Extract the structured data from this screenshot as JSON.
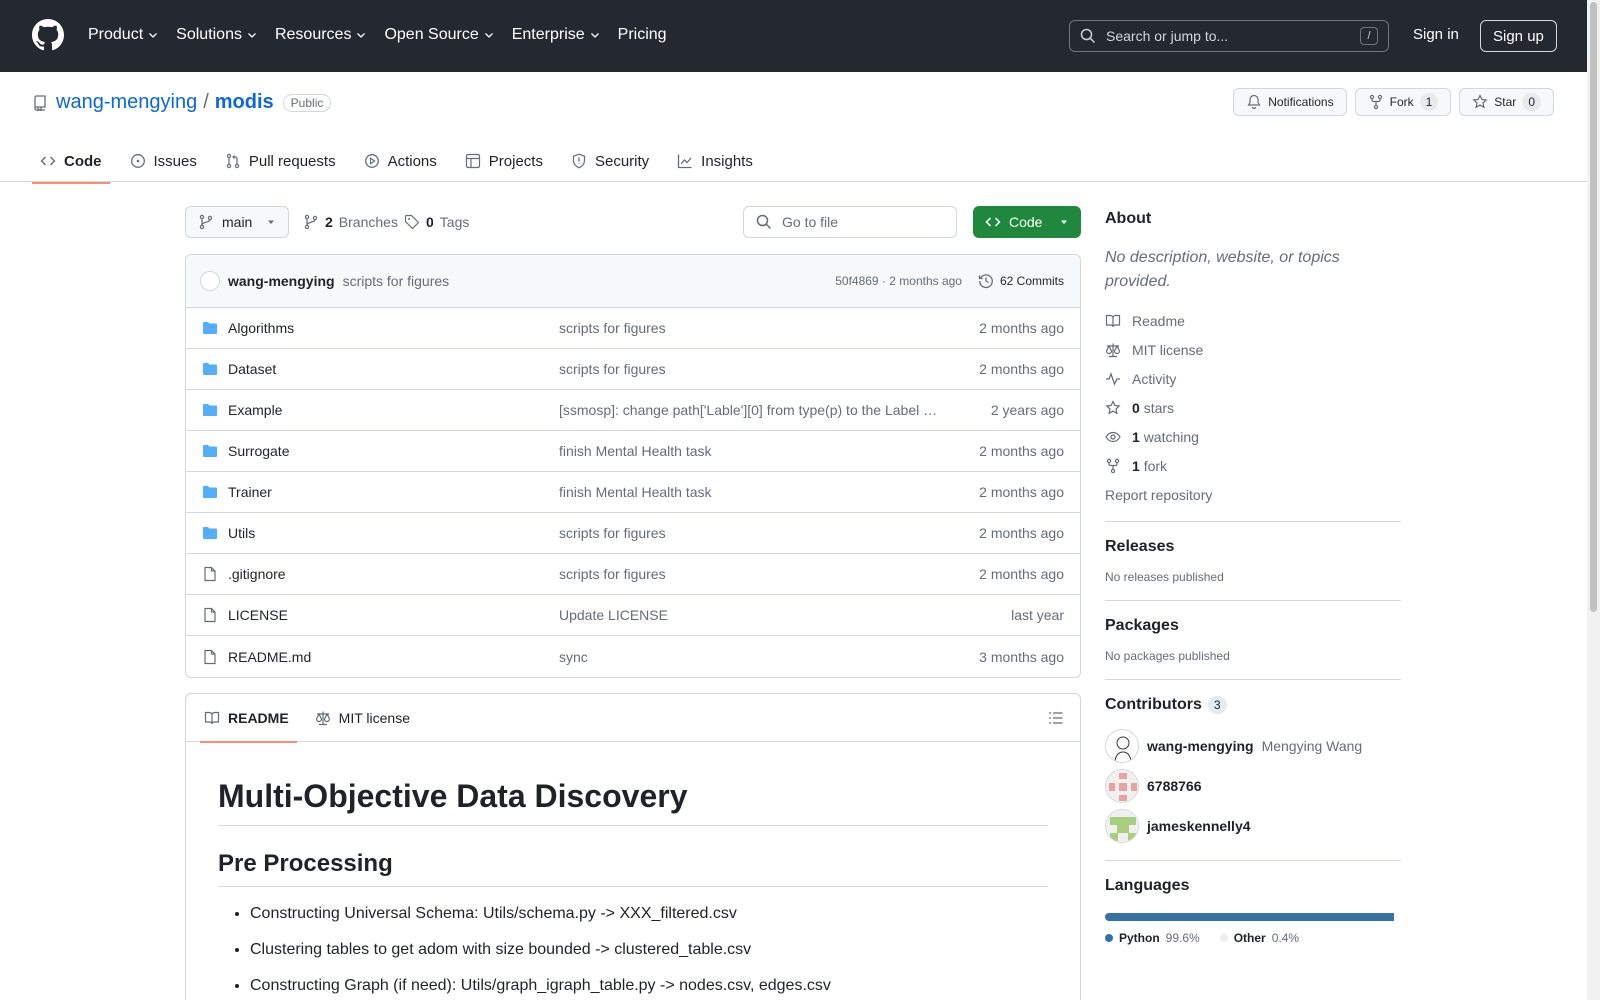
{
  "header": {
    "nav": [
      "Product",
      "Solutions",
      "Resources",
      "Open Source",
      "Enterprise",
      "Pricing"
    ],
    "search_placeholder": "Search or jump to...",
    "slash_key": "/",
    "signin": "Sign in",
    "signup": "Sign up"
  },
  "repo": {
    "owner": "wang-mengying",
    "slash": "/",
    "name": "modis",
    "visibility": "Public",
    "notifications": "Notifications",
    "fork_label": "Fork",
    "fork_count": "1",
    "star_label": "Star",
    "star_count": "0",
    "tabs": [
      "Code",
      "Issues",
      "Pull requests",
      "Actions",
      "Projects",
      "Security",
      "Insights"
    ]
  },
  "browser": {
    "branch": "main",
    "branches_count": "2",
    "branches_label": "Branches",
    "tags_count": "0",
    "tags_label": "Tags",
    "goto_placeholder": "Go to file",
    "code_button": "Code",
    "commit": {
      "author": "wang-mengying",
      "message": "scripts for figures",
      "sha_time": "50f4869 · 2 months ago",
      "commits": "62 Commits"
    },
    "files": [
      {
        "type": "dir",
        "name": "Algorithms",
        "message": "scripts for figures",
        "age": "2 months ago"
      },
      {
        "type": "dir",
        "name": "Dataset",
        "message": "scripts for figures",
        "age": "2 months ago"
      },
      {
        "type": "dir",
        "name": "Example",
        "message": "[ssmosp]: change path['Lable'][0] from type(p) to the Label …",
        "age": "2 years ago"
      },
      {
        "type": "dir",
        "name": "Surrogate",
        "message": "finish Mental Health task",
        "age": "2 months ago"
      },
      {
        "type": "dir",
        "name": "Trainer",
        "message": "finish Mental Health task",
        "age": "2 months ago"
      },
      {
        "type": "dir",
        "name": "Utils",
        "message": "scripts for figures",
        "age": "2 months ago"
      },
      {
        "type": "file",
        "name": ".gitignore",
        "message": "scripts for figures",
        "age": "2 months ago"
      },
      {
        "type": "file",
        "name": "LICENSE",
        "message": "Update LICENSE",
        "age": "last year"
      },
      {
        "type": "file",
        "name": "README.md",
        "message": "sync",
        "age": "3 months ago"
      }
    ]
  },
  "readme": {
    "tab_readme": "README",
    "tab_license": "MIT license",
    "h1": "Multi-Objective Data Discovery",
    "h2": "Pre Processing",
    "items": [
      "Constructing Universal Schema: Utils/schema.py -> XXX_filtered.csv",
      "Clustering tables to get adom with size bounded -> clustered_table.csv",
      "Constructing Graph (if need): Utils/graph_igraph_table.py -> nodes.csv, edges.csv"
    ]
  },
  "sidebar": {
    "about_title": "About",
    "about_desc": "No description, website, or topics provided.",
    "links": {
      "readme": "Readme",
      "license": "MIT license",
      "activity": "Activity",
      "stars_count": "0",
      "stars_label": "stars",
      "watching_count": "1",
      "watching_label": "watching",
      "fork_count": "1",
      "fork_label": "fork"
    },
    "report": "Report repository",
    "releases_title": "Releases",
    "releases_text": "No releases published",
    "packages_title": "Packages",
    "packages_text": "No packages published",
    "contributors_title": "Contributors",
    "contributors_count": "3",
    "contributors": [
      {
        "login": "wang-mengying",
        "name": "Mengying Wang"
      },
      {
        "login": "6788766",
        "name": ""
      },
      {
        "login": "jameskennelly4",
        "name": ""
      }
    ],
    "languages_title": "Languages",
    "languages": [
      {
        "name": "Python",
        "percent": "99.6%",
        "fraction": 0.996,
        "color": "#3572A5"
      },
      {
        "name": "Other",
        "percent": "0.4%",
        "fraction": 0.004,
        "color": "#ededed"
      }
    ]
  }
}
